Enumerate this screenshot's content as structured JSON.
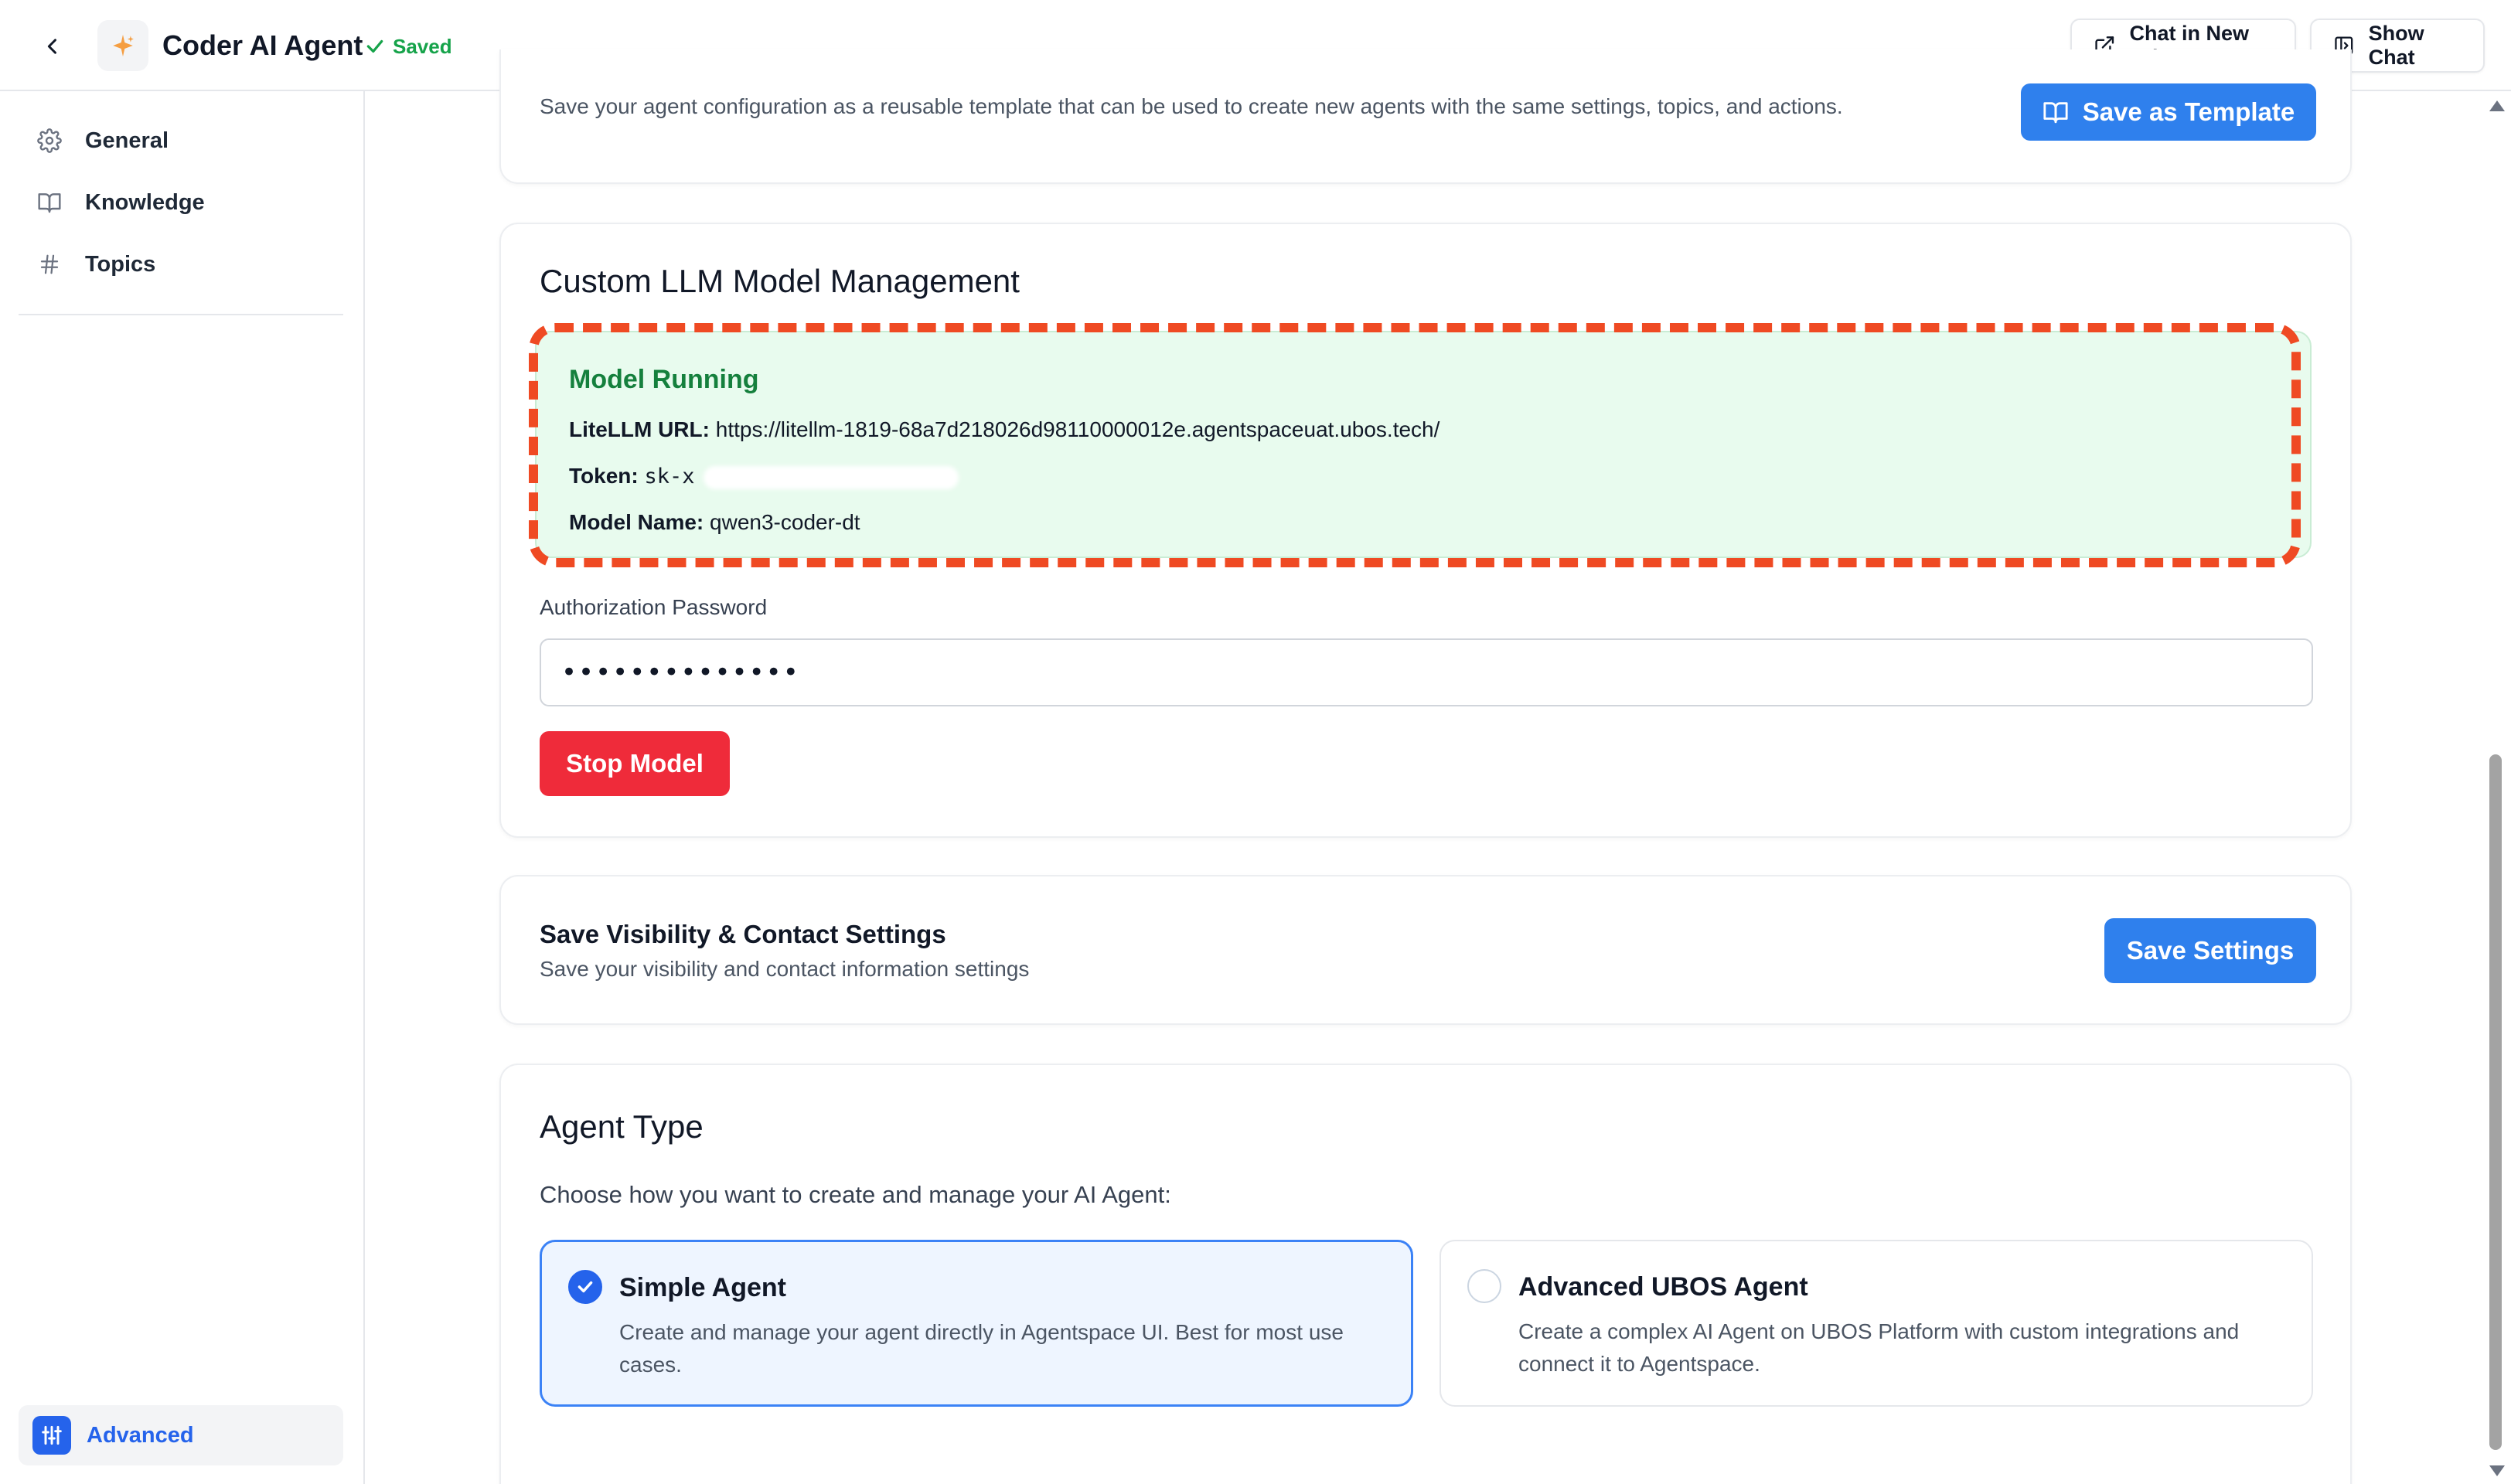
{
  "header": {
    "agent_name": "Coder AI Agent",
    "saved_label": "Saved",
    "chat_new_tab_label": "Chat in New Tab",
    "show_chat_label": "Show Chat"
  },
  "sidebar": {
    "items": [
      {
        "label": "General",
        "icon": "gear-icon"
      },
      {
        "label": "Knowledge",
        "icon": "book-icon"
      },
      {
        "label": "Topics",
        "icon": "hash-icon"
      }
    ],
    "advanced_label": "Advanced"
  },
  "template": {
    "description": "Save your agent configuration as a reusable template that can be used to create new agents with the same settings, topics, and actions.",
    "button_label": "Save as Template"
  },
  "llm": {
    "title": "Custom LLM Model Management",
    "status": "Model Running",
    "litellm_url_label": "LiteLLM URL:",
    "litellm_url": "https://litellm-1819-68a7d218026d98110000012e.agentspaceuat.ubos.tech/",
    "token_label": "Token:",
    "token": "sk-x",
    "model_name_label": "Model Name:",
    "model_name": "qwen3-coder-dt",
    "password_label": "Authorization Password",
    "password_value": "••••••••••••••",
    "stop_button": "Stop Model"
  },
  "visibility": {
    "title": "Save Visibility & Contact Settings",
    "subtitle": "Save your visibility and contact information settings",
    "button_label": "Save Settings"
  },
  "agent_type": {
    "title": "Agent Type",
    "description": "Choose how you want to create and manage your AI Agent:",
    "options": [
      {
        "title": "Simple Agent",
        "description": "Create and manage your agent directly in Agentspace UI. Best for most use cases.",
        "selected": true
      },
      {
        "title": "Advanced UBOS Agent",
        "description": "Create a complex AI Agent on UBOS Platform with custom integrations and connect it to Agentspace.",
        "selected": false
      }
    ]
  },
  "colors": {
    "primary": "#2f80ed",
    "danger": "#ef2b3a",
    "success": "#16a34a",
    "highlight": "#ef4a23"
  }
}
